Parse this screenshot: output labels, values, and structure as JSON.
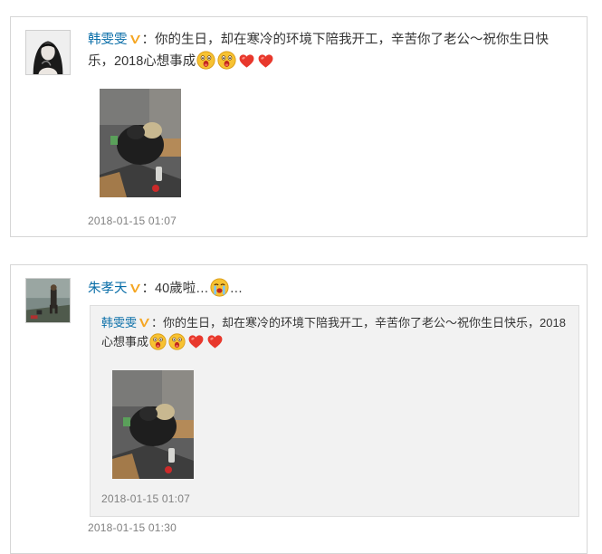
{
  "post1": {
    "author": "韩雯雯",
    "separator": "：",
    "text_before": "你的生日，却在寒冷的环境下陪我开工，辛苦你了老公～祝你生日快乐，2018心想事成",
    "emojis": [
      "surprised-face-icon",
      "surprised-face-icon",
      "red-heart-icon",
      "red-heart-icon"
    ],
    "timestamp": "2018-01-15 01:07"
  },
  "post2": {
    "author": "朱孝天",
    "separator": "：",
    "text_before": "40歲啦",
    "ellipsis1": "…",
    "ellipsis2": "…",
    "emoji": "crying-face-icon",
    "timestamp": "2018-01-15 01:30",
    "repost": {
      "author": "韩雯雯",
      "separator": "：",
      "text_before": "你的生日，却在寒冷的环境下陪我开工，辛苦你了老公～祝你生日快乐，2018心想事成",
      "emojis": [
        "surprised-face-icon",
        "surprised-face-icon",
        "red-heart-icon",
        "red-heart-icon"
      ],
      "timestamp": "2018-01-15 01:07"
    }
  },
  "colors": {
    "link": "#0a6ea8",
    "timestamp": "#808080",
    "repost_bg": "#f2f2f2",
    "verified_badge": "#f5a623",
    "heart": "#e8382c",
    "emoji_face": "#f7c232"
  }
}
